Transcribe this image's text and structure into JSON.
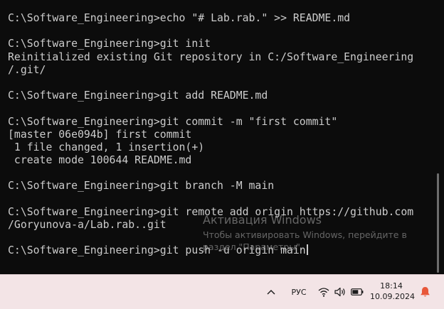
{
  "terminal": {
    "lines": [
      "C:\\Software_Engineering>echo \"# Lab.rab.\" >> README.md",
      "",
      "C:\\Software_Engineering>git init",
      "Reinitialized existing Git repository in C:/Software_Engineering",
      "/.git/",
      "",
      "C:\\Software_Engineering>git add README.md",
      "",
      "C:\\Software_Engineering>git commit -m \"first commit\"",
      "[master 06e094b] first commit",
      " 1 file changed, 1 insertion(+)",
      " create mode 100644 README.md",
      "",
      "C:\\Software_Engineering>git branch -M main",
      "",
      "C:\\Software_Engineering>git remote add origin https://github.com",
      "/Goryunova-a/Lab.rab..git",
      "",
      "C:\\Software_Engineering>git push -u origin main"
    ],
    "text_color": "#cccccc",
    "background": "#0c0c0c"
  },
  "activation_watermark": {
    "title": "Активация Windows",
    "text": "Чтобы активировать Windows, перейдите в раздел \"Параметры\"."
  },
  "taskbar": {
    "background": "#f3e4e6",
    "language": "РУС",
    "time": "18:14",
    "date": "10.09.2024",
    "notification_color": "#e8573a",
    "icons": [
      "chevron-up-icon",
      "wifi-icon",
      "volume-icon",
      "battery-icon",
      "bell-icon"
    ]
  }
}
